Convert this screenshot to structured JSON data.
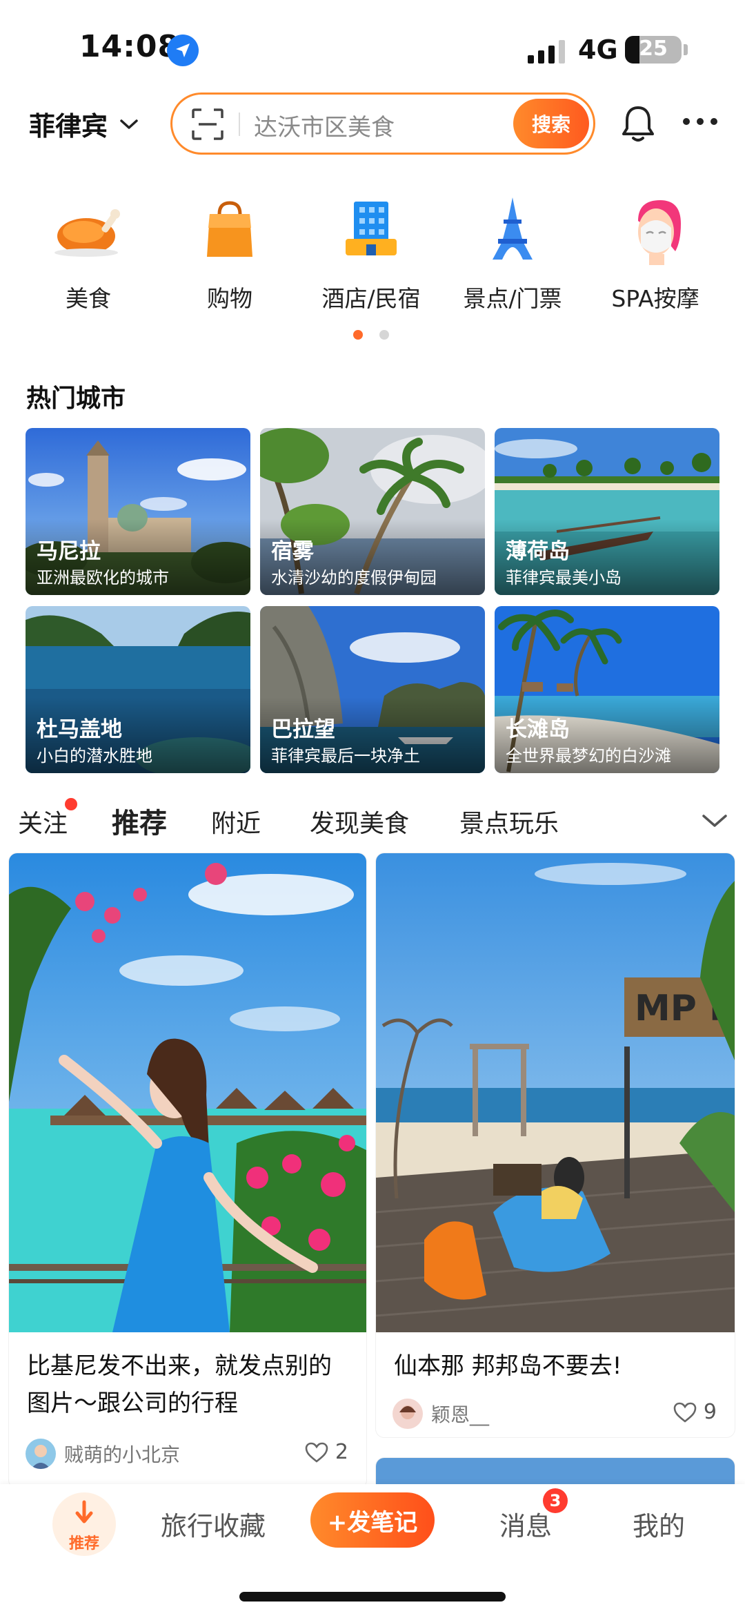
{
  "status_bar": {
    "time": "14:08",
    "network": "4G",
    "battery": "25",
    "battery_level": 0.25
  },
  "header": {
    "city": "菲律宾",
    "search_placeholder": "达沃市区美食",
    "search_button": "搜索"
  },
  "categories": [
    {
      "label": "美食",
      "icon": "roast-chicken-icon"
    },
    {
      "label": "购物",
      "icon": "shopping-bag-icon"
    },
    {
      "label": "酒店/民宿",
      "icon": "hotel-building-icon"
    },
    {
      "label": "景点/门票",
      "icon": "eiffel-tower-icon"
    },
    {
      "label": "SPA按摩",
      "icon": "face-mask-icon"
    }
  ],
  "page_indicator": {
    "current": 1,
    "total": 2
  },
  "hot_cities": {
    "title": "热门城市",
    "items": [
      {
        "name": "马尼拉",
        "desc": "亚洲最欧化的城市"
      },
      {
        "name": "宿雾",
        "desc": "水清沙幼的度假伊甸园"
      },
      {
        "name": "薄荷岛",
        "desc": "菲律宾最美小岛"
      },
      {
        "name": "杜马盖地",
        "desc": "小白的潜水胜地"
      },
      {
        "name": "巴拉望",
        "desc": "菲律宾最后一块净土"
      },
      {
        "name": "长滩岛",
        "desc": "全世界最梦幻的白沙滩"
      }
    ]
  },
  "feed_tabs": [
    "关注",
    "推荐",
    "附近",
    "发现美食",
    "景点玩乐"
  ],
  "feed_active_tab": "推荐",
  "feed": [
    {
      "title_line1": "比基尼发不出来，就发点别的",
      "title_line2": "图片～跟公司的行程",
      "author": "贼萌的小北京",
      "likes": "2"
    },
    {
      "title_line1": "仙本那 邦邦岛不要去!",
      "title_line2": "",
      "author": "颖恩__",
      "likes": "9",
      "sign_text": "MP R"
    }
  ],
  "bottom_nav": {
    "home": "推荐",
    "favorites": "旅行收藏",
    "post": "+发笔记",
    "messages": "消息",
    "messages_badge": "3",
    "me": "我的"
  },
  "colors": {
    "accent": "#ff6a2a",
    "badge": "#ff3b2f",
    "location": "#1f7cf5"
  }
}
